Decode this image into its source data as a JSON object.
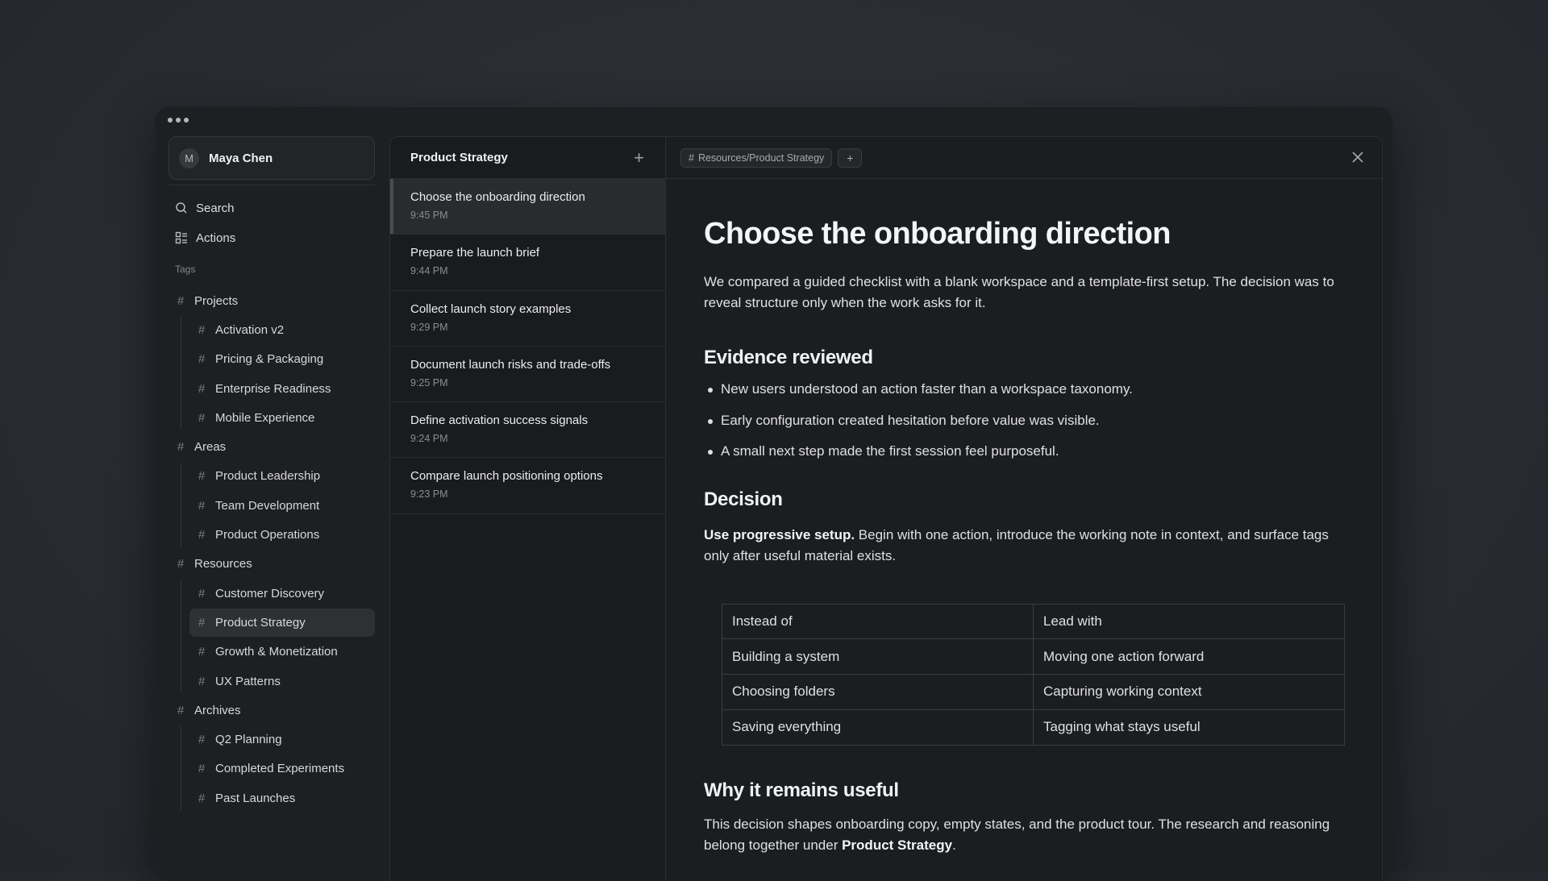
{
  "user": {
    "initial": "M",
    "name": "Maya Chen"
  },
  "sidebar": {
    "search_label": "Search",
    "actions_label": "Actions",
    "tags_label": "Tags",
    "groups": [
      {
        "label": "Projects",
        "children": [
          "Activation v2",
          "Pricing & Packaging",
          "Enterprise Readiness",
          "Mobile Experience"
        ]
      },
      {
        "label": "Areas",
        "children": [
          "Product Leadership",
          "Team Development",
          "Product Operations"
        ]
      },
      {
        "label": "Resources",
        "children": [
          "Customer Discovery",
          "Product Strategy",
          "Growth & Monetization",
          "UX Patterns"
        ]
      },
      {
        "label": "Archives",
        "children": [
          "Q2 Planning",
          "Completed Experiments",
          "Past Launches"
        ]
      }
    ],
    "selected": "Product Strategy"
  },
  "notes_list": {
    "title": "Product Strategy",
    "items": [
      {
        "title": "Choose the onboarding direction",
        "time": "9:45 PM"
      },
      {
        "title": "Prepare the launch brief",
        "time": "9:44 PM"
      },
      {
        "title": "Collect launch story examples",
        "time": "9:29 PM"
      },
      {
        "title": "Document launch risks and trade-offs",
        "time": "9:25 PM"
      },
      {
        "title": "Define activation success signals",
        "time": "9:24 PM"
      },
      {
        "title": "Compare launch positioning options",
        "time": "9:23 PM"
      }
    ]
  },
  "editor": {
    "path_chip": "Resources/Product Strategy",
    "title": "Choose the onboarding direction",
    "intro": "We compared a guided checklist with a blank workspace and a template-first setup. The decision was to reveal structure only when the work asks for it.",
    "evidence_heading": "Evidence reviewed",
    "evidence": [
      "New users understood an action faster than a workspace taxonomy.",
      "Early configuration created hesitation before value was visible.",
      "A small next step made the first session feel purposeful."
    ],
    "decision_heading": "Decision",
    "decision_bold": "Use progressive setup.",
    "decision_text": " Begin with one action, introduce the working note in context, and surface tags only after useful material exists.",
    "table": [
      [
        "Instead of",
        "Lead with"
      ],
      [
        "Building a system",
        "Moving one action forward"
      ],
      [
        "Choosing folders",
        "Capturing working context"
      ],
      [
        "Saving everything",
        "Tagging what stays useful"
      ]
    ],
    "why_heading": "Why it remains useful",
    "why_text": "This decision shapes onboarding copy, empty states, and the product tour. The research and reasoning belong together under ",
    "why_bold": "Product Strategy",
    "why_end": "."
  }
}
